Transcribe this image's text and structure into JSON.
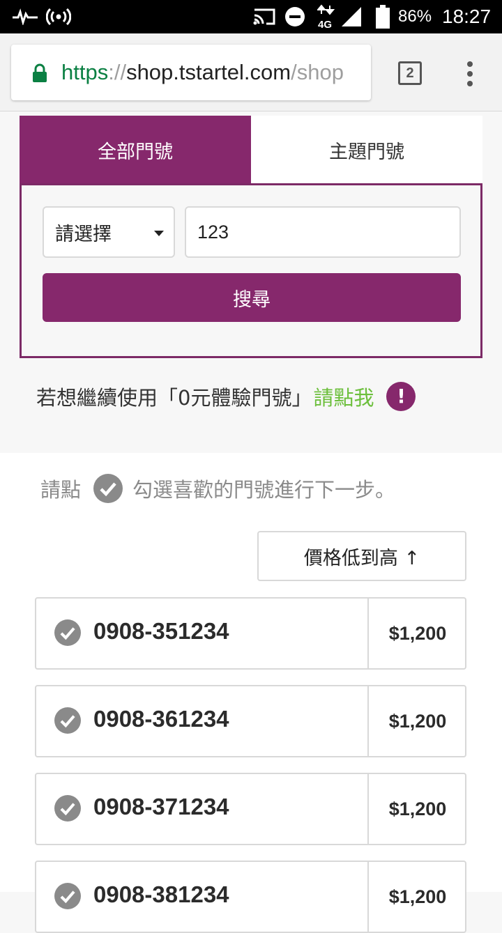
{
  "status_bar": {
    "battery": "86%",
    "time": "18:27",
    "network": "4G"
  },
  "browser": {
    "url_scheme": "https",
    "url_sep": "://",
    "url_host": "shop.tstartel.com",
    "url_path": "/shop",
    "tab_count": "2"
  },
  "tabs": [
    {
      "label": "全部門號"
    },
    {
      "label": "主題門號"
    }
  ],
  "search": {
    "select_label": "請選擇",
    "input_value": "123",
    "button_label": "搜尋"
  },
  "notice": {
    "text": "若想繼續使用「0元體驗門號」",
    "link": "請點我",
    "icon": "!"
  },
  "hint": {
    "prefix": "請點",
    "suffix": "勾選喜歡的門號進行下一步。"
  },
  "sort": {
    "label": "價格低到高 ↑"
  },
  "numbers": [
    {
      "number": "0908-351234",
      "price": "$1,200"
    },
    {
      "number": "0908-361234",
      "price": "$1,200"
    },
    {
      "number": "0908-371234",
      "price": "$1,200"
    },
    {
      "number": "0908-381234",
      "price": "$1,200"
    }
  ],
  "colors": {
    "brand": "#86286c",
    "link": "#6cbf3c",
    "secure": "#0b8043"
  }
}
